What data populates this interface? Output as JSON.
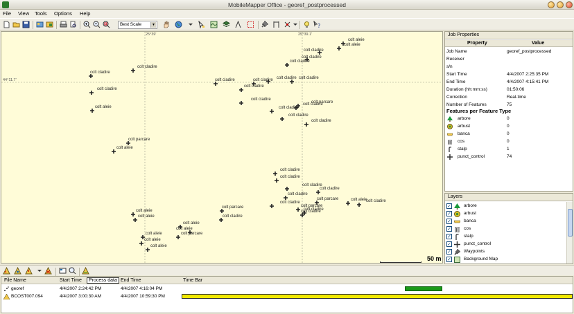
{
  "window": {
    "title": "MobileMapper Office - georef_postprocessed"
  },
  "menu": [
    "File",
    "View",
    "Tools",
    "Options",
    "Help"
  ],
  "toolbar": {
    "scale_select": "Best Scale"
  },
  "map": {
    "coords": {
      "top_left": "25°39'",
      "top_right": "25°39.1'",
      "left": "44°11.7'"
    },
    "scale_label": "50 m",
    "labels": [
      "colt aleie",
      "colt aleie",
      "colt cladire",
      "colt cladire",
      "colt cladire",
      "colt cladire",
      "colt cladire",
      "colt cladire",
      "colt cladire",
      "colt cladire",
      "colt cladire",
      "colt cladire",
      "colt cladire",
      "colt cladire",
      "colt cladire",
      "colt cladire",
      "colt cladire",
      "colt cladire",
      "colt aleie",
      "colt parcare",
      "colt aleie",
      "colt parcare",
      "colt cladire",
      "colt cladire",
      "colt cladire",
      "colt cladire",
      "colt cladire",
      "colt cladire",
      "colt cladire",
      "colt aleie",
      "colt aleie",
      "colt parcare",
      "colt cladire",
      "colt aleie",
      "colt aleie",
      "colt parcare",
      "colt cladire",
      "colt aleie",
      "colt aleie",
      "colt parcare",
      "colt parcare",
      "colt cladire",
      "colt aleie",
      "colt aleie"
    ]
  },
  "job_properties": {
    "title": "Job Properties",
    "col_property": "Property",
    "col_value": "Value",
    "rows": [
      {
        "k": "Job Name",
        "v": "georef_postprocessed"
      },
      {
        "k": "Receiver",
        "v": ""
      },
      {
        "k": "s/n",
        "v": ""
      },
      {
        "k": "Start Time",
        "v": "4/4/2007  2:25:35 PM"
      },
      {
        "k": "End Time",
        "v": "4/4/2007  4:15:41 PM"
      },
      {
        "k": "Duration (hh:mm:ss)",
        "v": "01:50:06"
      },
      {
        "k": "Correction",
        "v": "Real-time"
      },
      {
        "k": "Number of Features",
        "v": "75"
      }
    ],
    "features_title": "Features per Feature Type",
    "features": [
      {
        "k": "arbore",
        "v": "0",
        "icon": "tree-icon"
      },
      {
        "k": "arbust",
        "v": "0",
        "icon": "bush-icon"
      },
      {
        "k": "banca",
        "v": "0",
        "icon": "bench-icon"
      },
      {
        "k": "cos",
        "v": "0",
        "icon": "trash-bin-icon"
      },
      {
        "k": "stalp",
        "v": "1",
        "icon": "pole-icon"
      },
      {
        "k": "punct_control",
        "v": "74",
        "icon": "cross-point-icon"
      }
    ]
  },
  "layers": {
    "title": "Layers",
    "items": [
      "arbore",
      "arbust",
      "banca",
      "cos",
      "stalp",
      "punct_control",
      "Waypoints",
      "Background Map"
    ]
  },
  "filelist": {
    "headers": {
      "file_name": "File Name",
      "start_time": "Start Time",
      "process_data": "Process data",
      "end_time": "End Time",
      "time_bar": "Time Bar"
    },
    "rows": [
      {
        "name": "georef",
        "start": "4/4/2007  2:24:42 PM",
        "end": "4/4/2007  4:16:04 PM"
      },
      {
        "name": "BCOST007.094",
        "start": "4/4/2007  3:00:30 AM",
        "end": "4/4/2007  10:59:30 PM"
      }
    ]
  },
  "colors": {
    "map_bg": "#fffcd8",
    "timebar_green": "#1a9a1a",
    "timebar_yellow": "#f0e800"
  }
}
